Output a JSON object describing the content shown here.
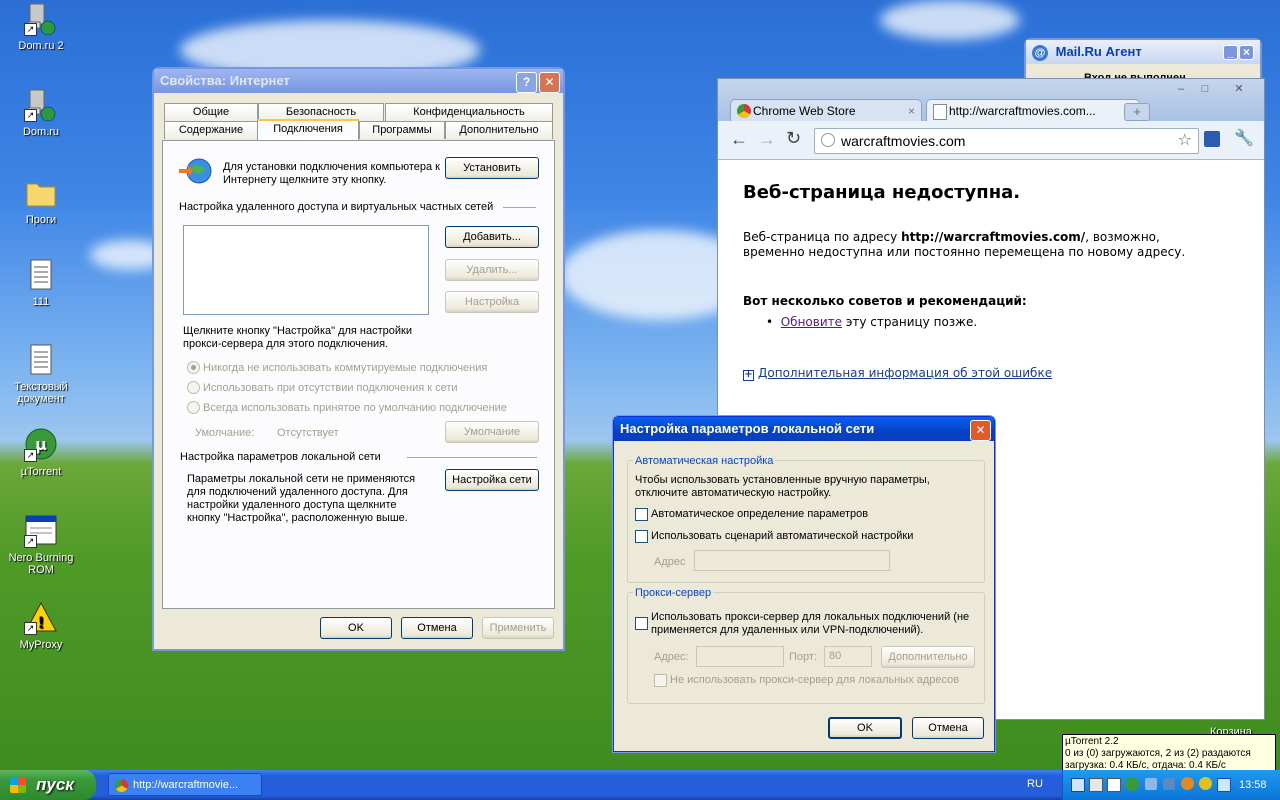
{
  "desktop": {
    "icons": [
      {
        "label": "Dom.ru 2",
        "icon": "network-computer-icon"
      },
      {
        "label": "Dom.ru",
        "icon": "network-computer-icon"
      },
      {
        "label": "Проги",
        "icon": "folder-icon"
      },
      {
        "label": "111",
        "icon": "text-document-icon"
      },
      {
        "label": "Текстовый документ",
        "icon": "text-document-icon"
      },
      {
        "label": "µTorrent",
        "icon": "utorrent-icon"
      },
      {
        "label": "Nero Burning ROM",
        "icon": "nero-icon"
      },
      {
        "label": "MyProxy",
        "icon": "warning-icon"
      }
    ]
  },
  "mailru": {
    "title": "Mail.Ru Агент",
    "status": "Вход не выполнен"
  },
  "inet": {
    "title": "Свойства: Интернет",
    "tabs_row1": [
      "Общие",
      "Безопасность",
      "Конфиденциальность"
    ],
    "tabs_row2": [
      "Содержание",
      "Подключения",
      "Программы",
      "Дополнительно"
    ],
    "setup_text": "Для установки подключения компьютера к Интернету щелкните эту кнопку.",
    "setup_btn": "Установить",
    "dialup_header": "Настройка удаленного доступа и виртуальных частных сетей",
    "add_btn": "Добавить...",
    "remove_btn": "Удалить...",
    "settings_btn": "Настройка",
    "proxy_hint": "Щелкните кнопку \"Настройка\" для настройки прокси-сервера для этого подключения.",
    "radio1": "Никогда не использовать коммутируемые подключения",
    "radio2": "Использовать при отсутствии подключения к сети",
    "radio3": "Всегда использовать принятое по умолчанию подключение",
    "default_label": "Умолчание:",
    "default_value": "Отсутствует",
    "default_btn": "Умолчание",
    "lan_header": "Настройка параметров локальной сети",
    "lan_text": "Параметры локальной сети не применяются для подключений удаленного доступа. Для настройки удаленного доступа щелкните кнопку \"Настройка\", расположенную выше.",
    "lan_btn": "Настройка сети",
    "ok": "OK",
    "cancel": "Отмена",
    "apply": "Применить"
  },
  "chrome": {
    "tabs": [
      {
        "label": "Chrome Web Store"
      },
      {
        "label": "http://warcraftmovies.com..."
      }
    ],
    "url": "warcraftmovies.com",
    "heading": "Веб-страница недоступна.",
    "para_pre": "Веб-страница по адресу ",
    "para_url": "http://warcraftmovies.com/",
    "para_post": ", возможно, временно недоступна или постоянно перемещена по новому адресу.",
    "tips_header": "Вот несколько советов и рекомендаций:",
    "tip_link": "Обновите",
    "tip_rest": " эту страницу позже.",
    "more_info": "Дополнительная информация об этой ошибке"
  },
  "lan": {
    "title": "Настройка параметров локальной сети",
    "auto_group": "Автоматическая настройка",
    "auto_text": "Чтобы использовать установленные вручную параметры, отключите автоматическую настройку.",
    "auto_detect": "Автоматическое определение параметров",
    "auto_script": "Использовать сценарий автоматической настройки",
    "address_label": "Адрес",
    "proxy_group": "Прокси-сервер",
    "use_proxy": "Использовать прокси-сервер для локальных подключений (не применяется для удаленных или VPN-подключений).",
    "proxy_address_label": "Адрес:",
    "port_label": "Порт:",
    "port_value": "80",
    "advanced_btn": "Дополнительно",
    "bypass_local": "Не использовать прокси-сервер для локальных адресов",
    "ok": "OK",
    "cancel": "Отмена"
  },
  "taskbar": {
    "start": "пуск",
    "task_item": "http://warcraftmovie...",
    "lang": "RU",
    "time": "13:58",
    "recycle_label": "Корзина"
  },
  "tooltip": {
    "line1": "µTorrent 2.2",
    "line2": "0 из (0) загружаются, 2 из (2) раздаются",
    "line3": "загрузка: 0.4 КБ/с, отдача: 0.4 КБ/с"
  }
}
